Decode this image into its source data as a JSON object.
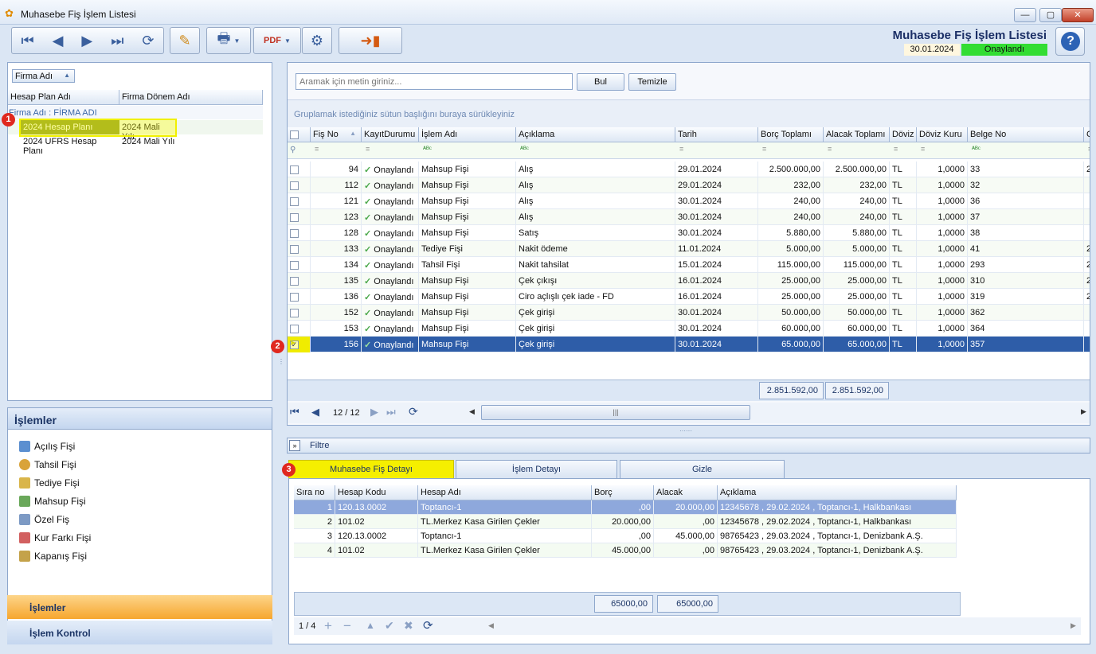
{
  "window": {
    "title": "Muhasebe Fiş İşlem Listesi"
  },
  "header": {
    "title": "Muhasebe Fiş İşlem Listesi",
    "date": "30.01.2024",
    "status": "Onaylandı"
  },
  "left": {
    "group_field": "Firma Adı",
    "columns": [
      "Hesap Plan Adı",
      "Firma Dönem Adı"
    ],
    "group_row": "Firma Adı : FİRMA ADI",
    "rows": [
      [
        "2024 Hesap Planı",
        "2024 Mali Yılı"
      ],
      [
        "2024 UFRS Hesap Planı",
        "2024 Mali Yılı"
      ]
    ]
  },
  "islemler": {
    "title": "İşlemler",
    "items": [
      "Açılış Fişi",
      "Tahsil Fişi",
      "Tediye Fişi",
      "Mahsup Fişi",
      "Özel Fiş",
      "Kur Farkı Fişi",
      "Kapanış Fişi"
    ],
    "nav": [
      "İşlemler",
      "İşlem Kontrol"
    ]
  },
  "search": {
    "placeholder": "Aramak için metin giriniz...",
    "find": "Bul",
    "clear": "Temizle",
    "group_hint": "Gruplamak istediğiniz sütun başlığını buraya sürükleyiniz"
  },
  "grid": {
    "columns": [
      "Fiş No",
      "KayıtDurumu",
      "İşlem Adı",
      "Açıklama",
      "Tarih",
      "Borç Toplamı",
      "Alacak Toplamı",
      "Döviz",
      "Döviz Kuru",
      "Belge No",
      "C"
    ],
    "rows": [
      [
        "94",
        "Onaylandı",
        "Mahsup Fişi",
        "Alış",
        "29.01.2024",
        "2.500.000,00",
        "2.500.000,00",
        "TL",
        "1,0000",
        "33",
        "2"
      ],
      [
        "112",
        "Onaylandı",
        "Mahsup Fişi",
        "Alış",
        "29.01.2024",
        "232,00",
        "232,00",
        "TL",
        "1,0000",
        "32",
        ""
      ],
      [
        "121",
        "Onaylandı",
        "Mahsup Fişi",
        "Alış",
        "30.01.2024",
        "240,00",
        "240,00",
        "TL",
        "1,0000",
        "36",
        ""
      ],
      [
        "123",
        "Onaylandı",
        "Mahsup Fişi",
        "Alış",
        "30.01.2024",
        "240,00",
        "240,00",
        "TL",
        "1,0000",
        "37",
        ""
      ],
      [
        "128",
        "Onaylandı",
        "Mahsup Fişi",
        "Satış",
        "30.01.2024",
        "5.880,00",
        "5.880,00",
        "TL",
        "1,0000",
        "38",
        ""
      ],
      [
        "133",
        "Onaylandı",
        "Tediye Fişi",
        "Nakit ödeme",
        "11.01.2024",
        "5.000,00",
        "5.000,00",
        "TL",
        "1,0000",
        "41",
        "2"
      ],
      [
        "134",
        "Onaylandı",
        "Tahsil Fişi",
        "Nakit tahsilat",
        "15.01.2024",
        "115.000,00",
        "115.000,00",
        "TL",
        "1,0000",
        "293",
        "2"
      ],
      [
        "135",
        "Onaylandı",
        "Mahsup Fişi",
        "Çek çıkışı",
        "16.01.2024",
        "25.000,00",
        "25.000,00",
        "TL",
        "1,0000",
        "310",
        "2"
      ],
      [
        "136",
        "Onaylandı",
        "Mahsup Fişi",
        "Ciro açlışlı çek iade - FD",
        "16.01.2024",
        "25.000,00",
        "25.000,00",
        "TL",
        "1,0000",
        "319",
        "2"
      ],
      [
        "152",
        "Onaylandı",
        "Mahsup Fişi",
        "Çek girişi",
        "30.01.2024",
        "50.000,00",
        "50.000,00",
        "TL",
        "1,0000",
        "362",
        ""
      ],
      [
        "153",
        "Onaylandı",
        "Mahsup Fişi",
        "Çek girişi",
        "30.01.2024",
        "60.000,00",
        "60.000,00",
        "TL",
        "1,0000",
        "364",
        ""
      ],
      [
        "156",
        "Onaylandı",
        "Mahsup Fişi",
        "Çek girişi",
        "30.01.2024",
        "65.000,00",
        "65.000,00",
        "TL",
        "1,0000",
        "357",
        ""
      ]
    ],
    "total_borc": "2.851.592,00",
    "total_alacak": "2.851.592,00",
    "pager": "12 / 12"
  },
  "filter": {
    "label": "Filtre"
  },
  "tabs": [
    "Muhasebe Fiş Detayı",
    "İşlem Detayı",
    "Gizle"
  ],
  "detail": {
    "columns": [
      "Sıra no",
      "Hesap Kodu",
      "Hesap Adı",
      "Borç",
      "Alacak",
      "Açıklama"
    ],
    "rows": [
      [
        "1",
        "120.13.0002",
        "Toptancı-1",
        ",00",
        "20.000,00",
        "12345678 , 29.02.2024 , Toptancı-1, Halkbankası"
      ],
      [
        "2",
        "101.02",
        "TL.Merkez Kasa Girilen Çekler",
        "20.000,00",
        ",00",
        "12345678 , 29.02.2024 , Toptancı-1, Halkbankası"
      ],
      [
        "3",
        "120.13.0002",
        "Toptancı-1",
        ",00",
        "45.000,00",
        "98765423 , 29.03.2024 , Toptancı-1, Denizbank A.Ş."
      ],
      [
        "4",
        "101.02",
        "TL.Merkez Kasa Girilen Çekler",
        "45.000,00",
        ",00",
        "98765423 , 29.03.2024 , Toptancı-1, Denizbank A.Ş."
      ]
    ],
    "total_borc": "65000,00",
    "total_alacak": "65000,00",
    "pager": "1 / 4"
  },
  "badges": [
    "1",
    "2",
    "3"
  ]
}
